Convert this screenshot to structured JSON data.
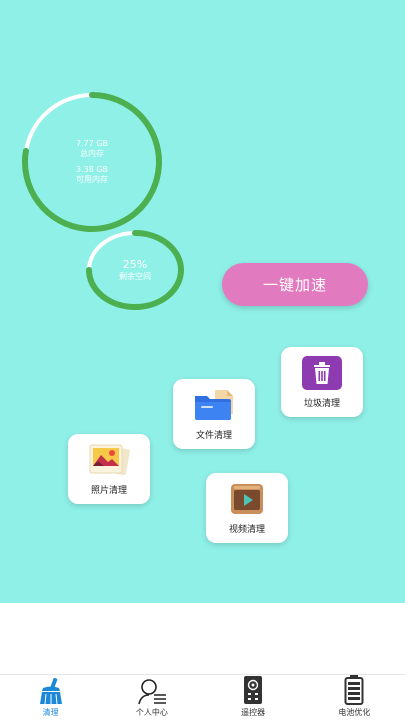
{
  "memory": {
    "total_value": "7.77 GB",
    "total_label": "总内存",
    "free_value": "3.38 GB",
    "free_label": "可用内存"
  },
  "storage": {
    "percent": "25%",
    "label": "剩余空间"
  },
  "boost_button": "一键加速",
  "tools": {
    "trash": "垃圾清理",
    "files": "文件清理",
    "photos": "照片清理",
    "videos": "视频清理"
  },
  "nav": [
    {
      "label": "清理",
      "icon": "broom-icon",
      "active": true
    },
    {
      "label": "个人中心",
      "icon": "user-list-icon"
    },
    {
      "label": "遥控器",
      "icon": "remote-control-icon"
    },
    {
      "label": "电池优化",
      "icon": "battery-icon"
    }
  ],
  "colors": {
    "background": "#8ff0e8",
    "ring": "#4caf50",
    "button": "#e27ac0",
    "nav_active": "#1e88d8"
  }
}
